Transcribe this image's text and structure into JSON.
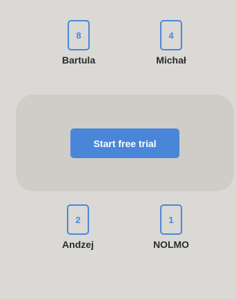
{
  "players": [
    {
      "card": "8",
      "name": "Bartula"
    },
    {
      "card": "4",
      "name": "Michał"
    },
    {
      "card": "2",
      "name": "Andzej"
    },
    {
      "card": "1",
      "name": "NOLMO"
    }
  ],
  "table": {
    "start_button_label": "Start free trial"
  },
  "colors": {
    "background": "#dad9d6",
    "table": "#cfcdc8",
    "accent": "#4a86d8",
    "text": "#2b2b2b"
  }
}
